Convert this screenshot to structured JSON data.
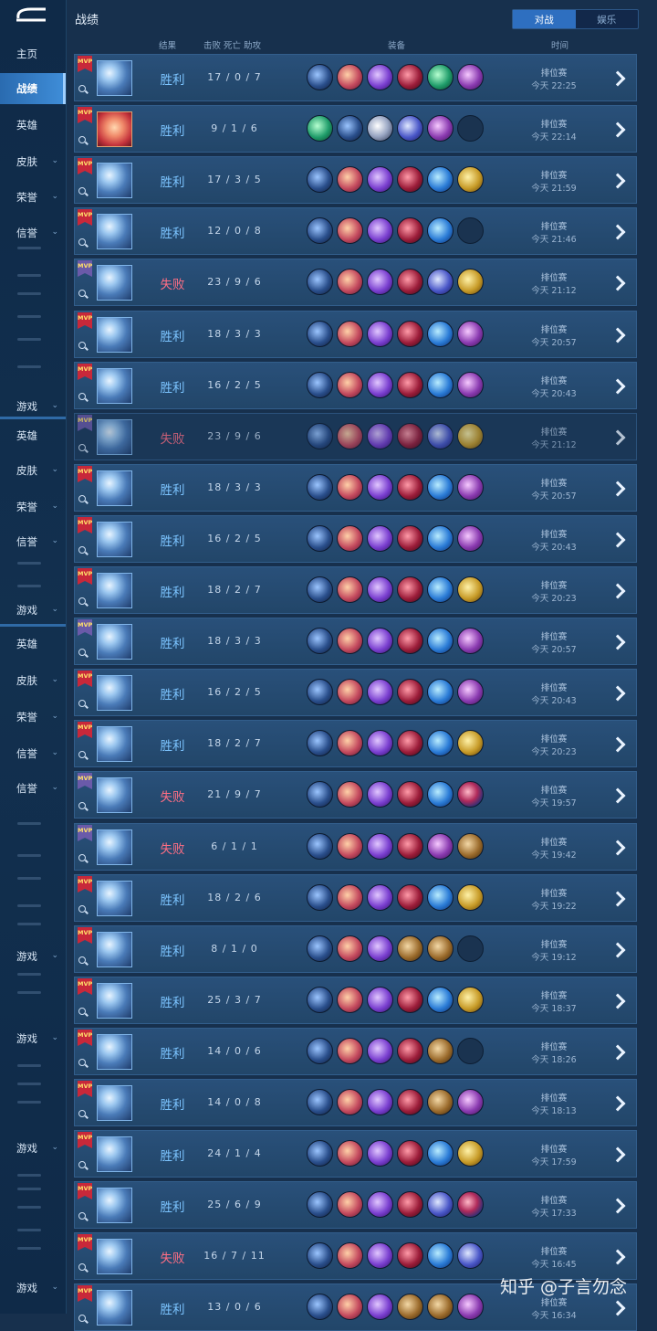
{
  "page": {
    "title": "战绩",
    "tabs": [
      "对战",
      "娱乐"
    ],
    "watermark": "知乎 @子言勿念"
  },
  "columns": {
    "result": "结果",
    "kda": "击败 死亡 助攻",
    "items": "装备",
    "time": "时间"
  },
  "sidebar": {
    "items": [
      {
        "label": "主页",
        "chevron": false,
        "active": false
      },
      {
        "label": "战绩",
        "chevron": false,
        "active": true
      },
      {
        "label": "英雄",
        "chevron": false,
        "active": false
      },
      {
        "label": "皮肤",
        "chevron": true,
        "active": false
      },
      {
        "label": "荣誉",
        "chevron": true,
        "active": false
      },
      {
        "label": "信誉",
        "chevron": true,
        "active": false
      },
      {
        "label": "游戏",
        "chevron": true,
        "active": false
      },
      {
        "label": "英雄",
        "chevron": false,
        "active": false
      },
      {
        "label": "皮肤",
        "chevron": true,
        "active": false
      },
      {
        "label": "荣誉",
        "chevron": true,
        "active": false
      },
      {
        "label": "信誉",
        "chevron": true,
        "active": false
      },
      {
        "label": "游戏",
        "chevron": true,
        "active": false
      },
      {
        "label": "英雄",
        "chevron": false,
        "active": false
      },
      {
        "label": "皮肤",
        "chevron": true,
        "active": false
      },
      {
        "label": "荣誉",
        "chevron": true,
        "active": false
      },
      {
        "label": "信誉",
        "chevron": true,
        "active": false
      },
      {
        "label": "信誉",
        "chevron": true,
        "active": false
      },
      {
        "label": "游戏",
        "chevron": true,
        "active": false
      },
      {
        "label": "游戏",
        "chevron": true,
        "active": false
      },
      {
        "label": "游戏",
        "chevron": true,
        "active": false
      },
      {
        "label": "游戏",
        "chevron": true,
        "active": false
      }
    ]
  },
  "matches": [
    {
      "mvp": "gold",
      "hero": "blue",
      "result": "胜利",
      "kda": "17 / 0 / 7",
      "items": [
        "boot",
        "book",
        "claw",
        "mask",
        "green",
        "tome"
      ],
      "mode": "排位赛",
      "time": "今天 22:25"
    },
    {
      "mvp": "gold",
      "hero": "fox",
      "result": "胜利",
      "kda": "9 / 1 / 6",
      "items": [
        "green",
        "boot",
        "ghost",
        "star",
        "tome",
        "empty"
      ],
      "mode": "排位赛",
      "time": "今天 22:14"
    },
    {
      "mvp": "gold",
      "hero": "blue",
      "result": "胜利",
      "kda": "17 / 3 / 5",
      "items": [
        "boot",
        "book",
        "claw",
        "mask",
        "wave",
        "gold"
      ],
      "mode": "排位赛",
      "time": "今天 21:59"
    },
    {
      "mvp": "gold",
      "hero": "blue",
      "result": "胜利",
      "kda": "12 / 0 / 8",
      "items": [
        "boot",
        "book",
        "claw",
        "mask",
        "wave",
        "empty"
      ],
      "mode": "排位赛",
      "time": "今天 21:46"
    },
    {
      "mvp": "silver",
      "hero": "blue",
      "result": "失败",
      "kda": "23 / 9 / 6",
      "items": [
        "boot",
        "book",
        "claw",
        "mask",
        "star",
        "gold"
      ],
      "mode": "排位赛",
      "time": "今天 21:12"
    },
    {
      "mvp": "gold",
      "hero": "blue",
      "result": "胜利",
      "kda": "18 / 3 / 3",
      "items": [
        "boot",
        "book",
        "claw",
        "mask",
        "wave",
        "tome"
      ],
      "mode": "排位赛",
      "time": "今天 20:57"
    },
    {
      "mvp": "gold",
      "hero": "blue",
      "result": "胜利",
      "kda": "16 / 2 / 5",
      "items": [
        "boot",
        "book",
        "claw",
        "mask",
        "wave",
        "tome"
      ],
      "mode": "排位赛",
      "time": "今天 20:43"
    },
    {
      "mvp": "silver",
      "hero": "blue",
      "result": "失败",
      "kda": "23 / 9 / 6",
      "items": [
        "boot",
        "book",
        "claw",
        "mask",
        "star",
        "gold"
      ],
      "mode": "排位赛",
      "time": "今天 21:12",
      "dim": true
    },
    {
      "mvp": "gold",
      "hero": "blue",
      "result": "胜利",
      "kda": "18 / 3 / 3",
      "items": [
        "boot",
        "book",
        "claw",
        "mask",
        "wave",
        "tome"
      ],
      "mode": "排位赛",
      "time": "今天 20:57"
    },
    {
      "mvp": "gold",
      "hero": "blue",
      "result": "胜利",
      "kda": "16 / 2 / 5",
      "items": [
        "boot",
        "book",
        "claw",
        "mask",
        "wave",
        "tome"
      ],
      "mode": "排位赛",
      "time": "今天 20:43"
    },
    {
      "mvp": "gold",
      "hero": "blue",
      "result": "胜利",
      "kda": "18 / 2 / 7",
      "items": [
        "boot",
        "book",
        "claw",
        "mask",
        "wave",
        "gold"
      ],
      "mode": "排位赛",
      "time": "今天 20:23"
    },
    {
      "mvp": "silver",
      "hero": "blue",
      "result": "胜利",
      "kda": "18 / 3 / 3",
      "items": [
        "boot",
        "book",
        "claw",
        "mask",
        "wave",
        "tome"
      ],
      "mode": "排位赛",
      "time": "今天 20:57"
    },
    {
      "mvp": "gold",
      "hero": "blue",
      "result": "胜利",
      "kda": "16 / 2 / 5",
      "items": [
        "boot",
        "book",
        "claw",
        "mask",
        "wave",
        "tome"
      ],
      "mode": "排位赛",
      "time": "今天 20:43"
    },
    {
      "mvp": "gold",
      "hero": "blue",
      "result": "胜利",
      "kda": "18 / 2 / 7",
      "items": [
        "boot",
        "book",
        "claw",
        "mask",
        "wave",
        "gold"
      ],
      "mode": "排位赛",
      "time": "今天 20:23"
    },
    {
      "mvp": "silver",
      "hero": "blue",
      "result": "失败",
      "kda": "21 / 9 / 7",
      "items": [
        "boot",
        "book",
        "claw",
        "mask",
        "wave",
        "orb"
      ],
      "mode": "排位赛",
      "time": "今天 19:57"
    },
    {
      "mvp": "silver",
      "hero": "blue",
      "result": "失败",
      "kda": "6 / 1 / 1",
      "items": [
        "boot",
        "book",
        "claw",
        "mask",
        "tome",
        "brown"
      ],
      "mode": "排位赛",
      "time": "今天 19:42"
    },
    {
      "mvp": "gold",
      "hero": "blue",
      "result": "胜利",
      "kda": "18 / 2 / 6",
      "items": [
        "boot",
        "book",
        "claw",
        "mask",
        "wave",
        "gold"
      ],
      "mode": "排位赛",
      "time": "今天 19:22"
    },
    {
      "mvp": "gold",
      "hero": "blue",
      "result": "胜利",
      "kda": "8 / 1 / 0",
      "items": [
        "boot",
        "book",
        "claw",
        "brown",
        "brown",
        "empty"
      ],
      "mode": "排位赛",
      "time": "今天 19:12"
    },
    {
      "mvp": "gold",
      "hero": "blue",
      "result": "胜利",
      "kda": "25 / 3 / 7",
      "items": [
        "boot",
        "book",
        "claw",
        "mask",
        "wave",
        "gold"
      ],
      "mode": "排位赛",
      "time": "今天 18:37"
    },
    {
      "mvp": "gold",
      "hero": "blue",
      "result": "胜利",
      "kda": "14 / 0 / 6",
      "items": [
        "boot",
        "book",
        "claw",
        "mask",
        "brown",
        "empty"
      ],
      "mode": "排位赛",
      "time": "今天 18:26"
    },
    {
      "mvp": "gold",
      "hero": "blue",
      "result": "胜利",
      "kda": "14 / 0 / 8",
      "items": [
        "boot",
        "book",
        "claw",
        "mask",
        "brown",
        "tome"
      ],
      "mode": "排位赛",
      "time": "今天 18:13"
    },
    {
      "mvp": "gold",
      "hero": "blue",
      "result": "胜利",
      "kda": "24 / 1 / 4",
      "items": [
        "boot",
        "book",
        "claw",
        "mask",
        "wave",
        "gold"
      ],
      "mode": "排位赛",
      "time": "今天 17:59"
    },
    {
      "mvp": "gold",
      "hero": "blue",
      "result": "胜利",
      "kda": "25 / 6 / 9",
      "items": [
        "boot",
        "book",
        "claw",
        "mask",
        "star",
        "orb"
      ],
      "mode": "排位赛",
      "time": "今天 17:33"
    },
    {
      "mvp": "gold",
      "hero": "blue",
      "result": "失败",
      "kda": "16 / 7 / 11",
      "items": [
        "boot",
        "book",
        "claw",
        "mask",
        "wave",
        "star"
      ],
      "mode": "排位赛",
      "time": "今天 16:45"
    },
    {
      "mvp": "gold",
      "hero": "blue",
      "result": "胜利",
      "kda": "13 / 0 / 6",
      "items": [
        "boot",
        "book",
        "claw",
        "brown",
        "brown",
        "tome"
      ],
      "mode": "排位赛",
      "time": "今天 16:34"
    }
  ]
}
